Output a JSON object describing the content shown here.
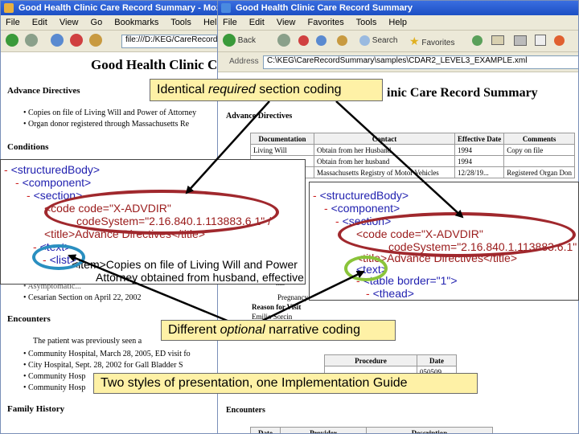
{
  "left_window": {
    "title": "Good Health Clinic Care Record Summary - Mozilla Fir",
    "menu": [
      "File",
      "Edit",
      "View",
      "Go",
      "Bookmarks",
      "Tools",
      "Help"
    ],
    "address": "file:///D:/KEG/CareRecordSum",
    "doc_title": "Good Health Clinic C",
    "advance_directives_heading": "Advance Directives",
    "advance_items": [
      "Copies on file of Living Will and Power of Attorney",
      "Organ donor registered through Massachusetts Re"
    ],
    "conditions_heading": "Conditions",
    "hidden_items": [
      "Asymptomatic...",
      "Cesarian Section on April 22, 2002"
    ],
    "encounters_heading": "Encounters",
    "encounters_intro": "The patient was previously seen a",
    "encounter_items": [
      "Community Hospital, March 28, 2005, ED visit fo",
      "City Hospital, Sept. 28, 2002 for Gall Bladder S",
      "Community Hosp",
      "Community Hosp"
    ],
    "family_history_heading": "Family History"
  },
  "right_window": {
    "title": "File Edit View Favorites Tools Help",
    "title_text": "Good Health Clinic Care Record Summary",
    "menu": [
      "File",
      "Edit",
      "View",
      "Favorites",
      "Tools",
      "Help"
    ],
    "toolbar": {
      "back": "Back",
      "search": "Search",
      "favorites": "Favorites"
    },
    "address_label": "Address",
    "address": "C:\\KEG\\CareRecordSummary\\samples\\CDAR2_LEVEL3_EXAMPLE.xml",
    "doc_title": "inic Care Record Summary",
    "advance_directives_heading": "Advance Directives",
    "table": {
      "headers": [
        "Documentation",
        "Contact",
        "Effective Date",
        "Comments"
      ],
      "rows": [
        [
          "Living Will",
          "Obtain from her Husband",
          "1994",
          "Copy on file"
        ],
        [
          "",
          "Obtain from her husband",
          "1994",
          ""
        ],
        [
          "",
          "Massachusetts Registry of Motor Vehicles",
          "12/28/19...",
          "Registered Organ Don"
        ]
      ]
    },
    "fragments": [
      "lon",
      "itis",
      "Pregnancy",
      "Reason for Visit",
      "Emilio Sorcin"
    ],
    "proc_headers": [
      "Procedure",
      "Date"
    ],
    "proc_value": "050509",
    "encounters_heading": "Encounters",
    "enc_headers": [
      "Date",
      "Provider",
      "Description"
    ]
  },
  "xml_left": {
    "lines": [
      [
        "- ",
        "<structuredBody>"
      ],
      [
        "- ",
        "<component>"
      ],
      [
        "- ",
        "<section>"
      ],
      [
        "",
        "<code code=\"X-ADVDIR\""
      ],
      [
        "",
        "codeSystem=\"2.16.840.1.113883.6.1\" /"
      ],
      [
        "",
        "<title>Advance Directives</title>"
      ],
      [
        "- ",
        "<text>"
      ],
      [
        "- ",
        "<list>"
      ],
      [
        "",
        "<item>Copies on file of Living Will and Power"
      ],
      [
        "",
        "Attorney obtained from husband, effective i"
      ]
    ]
  },
  "xml_right": {
    "lines": [
      [
        "- ",
        "<structuredBody>"
      ],
      [
        "- ",
        "<component>"
      ],
      [
        "- ",
        "<section>"
      ],
      [
        "",
        "<code code=\"X-ADVDIR\""
      ],
      [
        "",
        "codeSystem=\"2.16.840.1.113883.6.1\""
      ],
      [
        "",
        "<title>Advance Directives</title>"
      ],
      [
        "- ",
        "<text>"
      ],
      [
        "- ",
        "<table border=\"1\">"
      ],
      [
        "- ",
        "<thead>"
      ]
    ]
  },
  "callouts": {
    "identical": {
      "pre": "Identical ",
      "em": "required",
      "post": " section coding"
    },
    "different": {
      "pre": "Different ",
      "em": "optional",
      "post": " narrative coding"
    },
    "two_styles": "Two styles of presentation, one Implementation Guide"
  },
  "colors": {
    "oval_red": "#a0282d",
    "oval_blue": "#2a8fc0",
    "oval_green": "#8ac43a",
    "callout_fill": "#fef1a6"
  }
}
